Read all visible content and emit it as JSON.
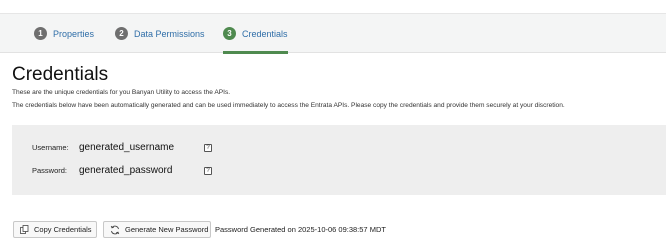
{
  "tabs": [
    {
      "number": "1",
      "label": "Properties"
    },
    {
      "number": "2",
      "label": "Data Permissions"
    },
    {
      "number": "3",
      "label": "Credentials",
      "active": true
    }
  ],
  "page": {
    "title": "Credentials",
    "desc_line1": "These are the unique credentials for you Banyan Utility to access the APIs.",
    "desc_line2": "The credentials below have been automatically generated and can be used immediately to access the Entrata APIs. Please copy the credentials and provide them securely at your discretion."
  },
  "credentials": {
    "username_label": "Username:",
    "username_value": "generated_username",
    "password_label": "Password:",
    "password_value": "generated_password"
  },
  "actions": {
    "copy_label": "Copy Credentials",
    "generate_label": "Generate New Password",
    "generated_text": "Password Generated on 2025-10-06 09:38:57 MDT"
  },
  "colors": {
    "accent": "#4f8a4f",
    "link": "#2f6ea8",
    "panel": "#eeeeee"
  }
}
